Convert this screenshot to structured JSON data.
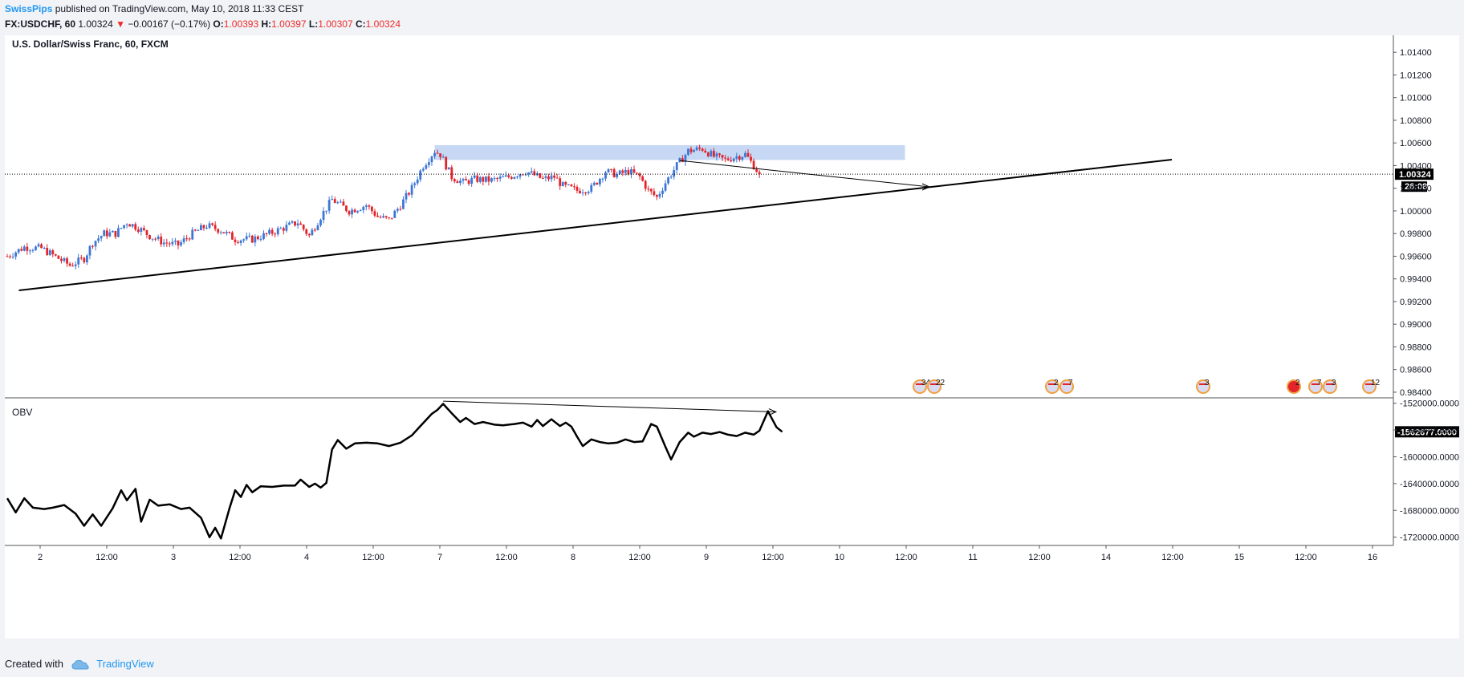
{
  "header": {
    "author": "SwissPips",
    "published_text": "published on TradingView.com, May 10, 2018 11:33 CEST",
    "symbol": "FX:USDCHF, 60",
    "last": "1.00324",
    "change": "−0.00167 (−0.17%)",
    "o_label": "O:",
    "o_value": "1.00393",
    "h_label": "H:",
    "h_value": "1.00397",
    "l_label": "L:",
    "l_value": "1.00307",
    "c_label": "C:",
    "c_value": "1.00324"
  },
  "footer": {
    "created_with": "Created with",
    "brand": "TradingView"
  },
  "colors": {
    "up": "#3d77d6",
    "down": "#e3242b",
    "zone": "#c6d8f4",
    "line": "#000000",
    "bg": "#ffffff",
    "axis_text": "#131722"
  },
  "icons": [
    "down-triangle-icon",
    "tradingview-cloud-icon",
    "us-flag-event-icon",
    "ch-flag-event-icon"
  ],
  "chart_data": [
    {
      "type": "candlestick",
      "title": "U.S. Dollar/Swiss Franc, 60, FXCM",
      "x_ticks": [
        "2",
        "12:00",
        "3",
        "12:00",
        "4",
        "12:00",
        "7",
        "12:00",
        "8",
        "12:00",
        "9",
        "12:00",
        "10",
        "12:00",
        "11",
        "12:00",
        "14",
        "12:00",
        "15",
        "12:00",
        "16"
      ],
      "x_range_bars": [
        -2,
        270
      ],
      "ylim": [
        0.9835,
        1.0155
      ],
      "y_ticks": [
        "1.01400",
        "1.01200",
        "1.01000",
        "1.00800",
        "1.00600",
        "1.00400",
        "1.00200",
        "1.00000",
        "0.99800",
        "0.99600",
        "0.99400",
        "0.99200",
        "0.99000",
        "0.98800",
        "0.98600",
        "0.98400"
      ],
      "last_price_label": "1.00324",
      "countdown_label": "26:08",
      "last_price": 1.00324,
      "ohlc_anchors": [
        [
          0,
          0.996
        ],
        [
          6,
          0.9968
        ],
        [
          12,
          0.9967
        ],
        [
          18,
          0.9958
        ],
        [
          22,
          0.9952
        ],
        [
          27,
          0.9958
        ],
        [
          30,
          0.9972
        ],
        [
          34,
          0.998
        ],
        [
          38,
          0.998
        ],
        [
          42,
          0.999
        ],
        [
          46,
          0.9985
        ],
        [
          50,
          0.9978
        ],
        [
          55,
          0.9972
        ],
        [
          60,
          0.997
        ],
        [
          65,
          0.998
        ],
        [
          70,
          0.9987
        ],
        [
          75,
          0.9983
        ],
        [
          80,
          0.9975
        ],
        [
          86,
          0.9975
        ],
        [
          92,
          0.998
        ],
        [
          97,
          0.9985
        ],
        [
          102,
          0.999
        ],
        [
          106,
          0.9978
        ],
        [
          110,
          0.9995
        ],
        [
          114,
          1.001
        ],
        [
          120,
          1.0
        ],
        [
          126,
          1.0005
        ],
        [
          130,
          0.9995
        ],
        [
          134,
          0.9992
        ],
        [
          138,
          1.0005
        ],
        [
          142,
          1.002
        ],
        [
          146,
          1.004
        ],
        [
          150,
          1.0053
        ],
        [
          152,
          1.005
        ],
        [
          154,
          1.004
        ],
        [
          156,
          1.003
        ],
        [
          160,
          1.0025
        ],
        [
          164,
          1.0028
        ],
        [
          170,
          1.0027
        ],
        [
          176,
          1.003
        ],
        [
          182,
          1.0035
        ],
        [
          188,
          1.0028
        ],
        [
          192,
          1.003
        ],
        [
          195,
          1.0022
        ],
        [
          200,
          1.0018
        ],
        [
          205,
          1.002
        ],
        [
          210,
          1.0035
        ],
        [
          214,
          1.0032
        ],
        [
          218,
          1.0035
        ],
        [
          222,
          1.003
        ],
        [
          225,
          1.0018
        ],
        [
          228,
          1.0012
        ],
        [
          231,
          1.0025
        ],
        [
          235,
          1.004
        ],
        [
          239,
          1.0053
        ],
        [
          244,
          1.0055
        ],
        [
          248,
          1.0048
        ],
        [
          252,
          1.0045
        ],
        [
          256,
          1.0048
        ],
        [
          259,
          1.005
        ],
        [
          262,
          1.004
        ],
        [
          264,
          1.0032
        ]
      ],
      "zone": {
        "bar_start": 150,
        "bar_end": 270,
        "price_low": 1.0045,
        "price_high": 1.0058
      },
      "trendlines": [
        {
          "from": [
            1,
            0.99268
          ],
          "to": [
            270,
            1.00414
          ]
        },
        {
          "from": [
            236,
            1.00445
          ],
          "to": [
            268,
            1.00355
          ],
          "arrow": true
        }
      ],
      "events": [
        {
          "bar": 269,
          "labels": [
            "34",
            "22"
          ]
        },
        {
          "bar": 309,
          "labels": [
            "2",
            "7"
          ]
        },
        {
          "bar": 353,
          "labels": [
            "3"
          ]
        },
        {
          "bar": 379,
          "labels": [
            "2"
          ]
        },
        {
          "bar": 387,
          "labels": [
            "7",
            "3"
          ]
        },
        {
          "bar": 401,
          "labels": [
            "12"
          ]
        }
      ]
    },
    {
      "type": "line",
      "title": "OBV",
      "ylim": [
        -1730000,
        -1512000
      ],
      "y_ticks": [
        "-1520000.0000",
        "-1560000.0000",
        "-1600000.0000",
        "-1640000.0000",
        "-1680000.0000",
        "-1720000.0000"
      ],
      "last_value_label": "-1562677.0000",
      "values_anchor": [
        [
          0,
          -1662000
        ],
        [
          3,
          -1683000
        ],
        [
          6,
          -1662000
        ],
        [
          9,
          -1676000
        ],
        [
          13,
          -1678000
        ],
        [
          16,
          -1676000
        ],
        [
          20,
          -1672000
        ],
        [
          24,
          -1685000
        ],
        [
          27,
          -1703000
        ],
        [
          30,
          -1686000
        ],
        [
          33,
          -1703000
        ],
        [
          37,
          -1677000
        ],
        [
          40,
          -1650000
        ],
        [
          42,
          -1665000
        ],
        [
          45,
          -1648000
        ],
        [
          47,
          -1697000
        ],
        [
          50,
          -1664000
        ],
        [
          53,
          -1673000
        ],
        [
          57,
          -1671000
        ],
        [
          61,
          -1678000
        ],
        [
          64,
          -1676000
        ],
        [
          68,
          -1691000
        ],
        [
          71,
          -1720000
        ],
        [
          73,
          -1706000
        ],
        [
          75,
          -1722000
        ],
        [
          78,
          -1677000
        ],
        [
          80,
          -1650000
        ],
        [
          82,
          -1660000
        ],
        [
          84,
          -1642000
        ],
        [
          86,
          -1653000
        ],
        [
          89,
          -1644000
        ],
        [
          93,
          -1645000
        ],
        [
          97,
          -1643000
        ],
        [
          101,
          -1643000
        ],
        [
          103,
          -1634000
        ],
        [
          106,
          -1645000
        ],
        [
          108,
          -1640000
        ],
        [
          110,
          -1646000
        ],
        [
          112,
          -1639000
        ],
        [
          114,
          -1589000
        ],
        [
          116,
          -1575000
        ],
        [
          119,
          -1588000
        ],
        [
          122,
          -1580000
        ],
        [
          126,
          -1579000
        ],
        [
          130,
          -1580000
        ],
        [
          134,
          -1584000
        ],
        [
          138,
          -1579000
        ],
        [
          142,
          -1568000
        ],
        [
          145,
          -1554000
        ],
        [
          149,
          -1536000
        ],
        [
          151,
          -1530000
        ],
        [
          153,
          -1521000
        ],
        [
          156,
          -1535000
        ],
        [
          159,
          -1548000
        ],
        [
          161,
          -1542000
        ],
        [
          164,
          -1551000
        ],
        [
          167,
          -1548000
        ],
        [
          171,
          -1552000
        ],
        [
          174,
          -1553000
        ],
        [
          178,
          -1551000
        ],
        [
          181,
          -1549000
        ],
        [
          184,
          -1555000
        ],
        [
          186,
          -1545000
        ],
        [
          188,
          -1554000
        ],
        [
          191,
          -1544000
        ],
        [
          194,
          -1554000
        ],
        [
          196,
          -1549000
        ],
        [
          198,
          -1555000
        ],
        [
          200,
          -1570000
        ],
        [
          202,
          -1584000
        ],
        [
          205,
          -1574000
        ],
        [
          208,
          -1578000
        ],
        [
          211,
          -1580000
        ],
        [
          214,
          -1579000
        ],
        [
          217,
          -1574000
        ],
        [
          220,
          -1578000
        ],
        [
          223,
          -1577000
        ],
        [
          226,
          -1551000
        ],
        [
          228,
          -1555000
        ],
        [
          231,
          -1585000
        ],
        [
          233,
          -1604000
        ],
        [
          236,
          -1578000
        ],
        [
          239,
          -1564000
        ],
        [
          241,
          -1570000
        ],
        [
          244,
          -1564000
        ],
        [
          247,
          -1566000
        ],
        [
          250,
          -1563000
        ],
        [
          253,
          -1567000
        ],
        [
          256,
          -1569000
        ],
        [
          259,
          -1564000
        ],
        [
          262,
          -1567000
        ],
        [
          264,
          -1561000
        ],
        [
          267,
          -1532000
        ],
        [
          270,
          -1556000
        ],
        [
          272,
          -1562677
        ]
      ],
      "trendlines": [
        {
          "from": [
            153,
            -1517000
          ],
          "to": [
            267,
            -1533000
          ],
          "arrow": true
        }
      ]
    }
  ]
}
